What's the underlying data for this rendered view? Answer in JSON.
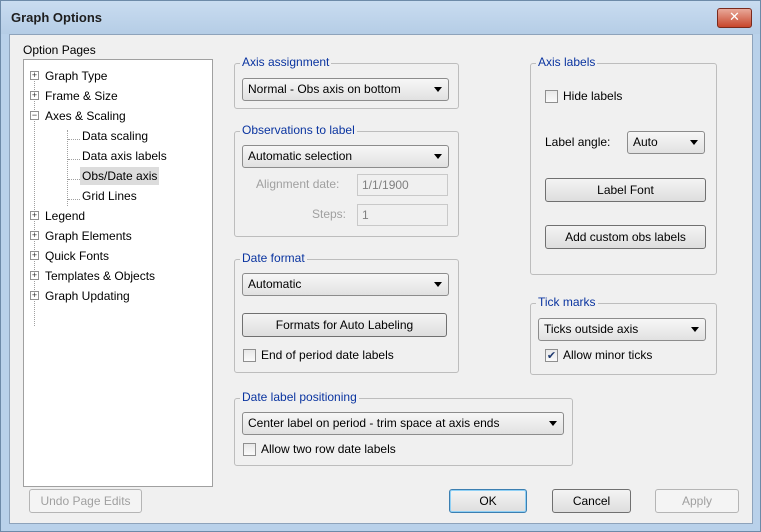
{
  "window": {
    "title": "Graph Options",
    "close_glyph": "✕"
  },
  "option_pages": {
    "label": "Option Pages",
    "items": [
      {
        "label": "Graph Type",
        "expander": "+"
      },
      {
        "label": "Frame & Size",
        "expander": "+"
      },
      {
        "label": "Axes & Scaling",
        "expander": "−"
      },
      {
        "label": "Data scaling"
      },
      {
        "label": "Data axis labels"
      },
      {
        "label": "Obs/Date axis",
        "selected": true
      },
      {
        "label": "Grid Lines"
      },
      {
        "label": "Legend",
        "expander": "+"
      },
      {
        "label": "Graph Elements",
        "expander": "+"
      },
      {
        "label": "Quick Fonts",
        "expander": "+"
      },
      {
        "label": "Templates & Objects",
        "expander": "+"
      },
      {
        "label": "Graph Updating",
        "expander": "+"
      }
    ]
  },
  "axis_assignment": {
    "title": "Axis assignment",
    "value": "Normal - Obs axis on bottom"
  },
  "observations_to_label": {
    "title": "Observations to label",
    "value": "Automatic selection",
    "alignment_label": "Alignment date:",
    "alignment_value": "1/1/1900",
    "steps_label": "Steps:",
    "steps_value": "1"
  },
  "date_format": {
    "title": "Date format",
    "value": "Automatic",
    "formats_button": "Formats for Auto Labeling",
    "end_of_period_label": "End of period date labels",
    "end_of_period_checked": false
  },
  "date_label_positioning": {
    "title": "Date label positioning",
    "value": "Center label on period - trim space at axis ends",
    "two_row_label": "Allow two row date labels",
    "two_row_checked": false
  },
  "axis_labels": {
    "title": "Axis labels",
    "hide_label": "Hide labels",
    "hide_checked": false,
    "angle_label": "Label angle:",
    "angle_value": "Auto",
    "label_font_button": "Label Font",
    "custom_obs_button": "Add custom obs labels"
  },
  "tick_marks": {
    "title": "Tick marks",
    "value": "Ticks outside axis",
    "minor_label": "Allow minor ticks",
    "minor_checked": true,
    "check_glyph": "✔"
  },
  "footer": {
    "undo_button": "Undo Page Edits",
    "ok_button": "OK",
    "cancel_button": "Cancel",
    "apply_button": "Apply"
  },
  "colors": {
    "group_title": "#0a34a0",
    "title_bar": "#b9d1ea",
    "close_button": "#c7462b"
  }
}
